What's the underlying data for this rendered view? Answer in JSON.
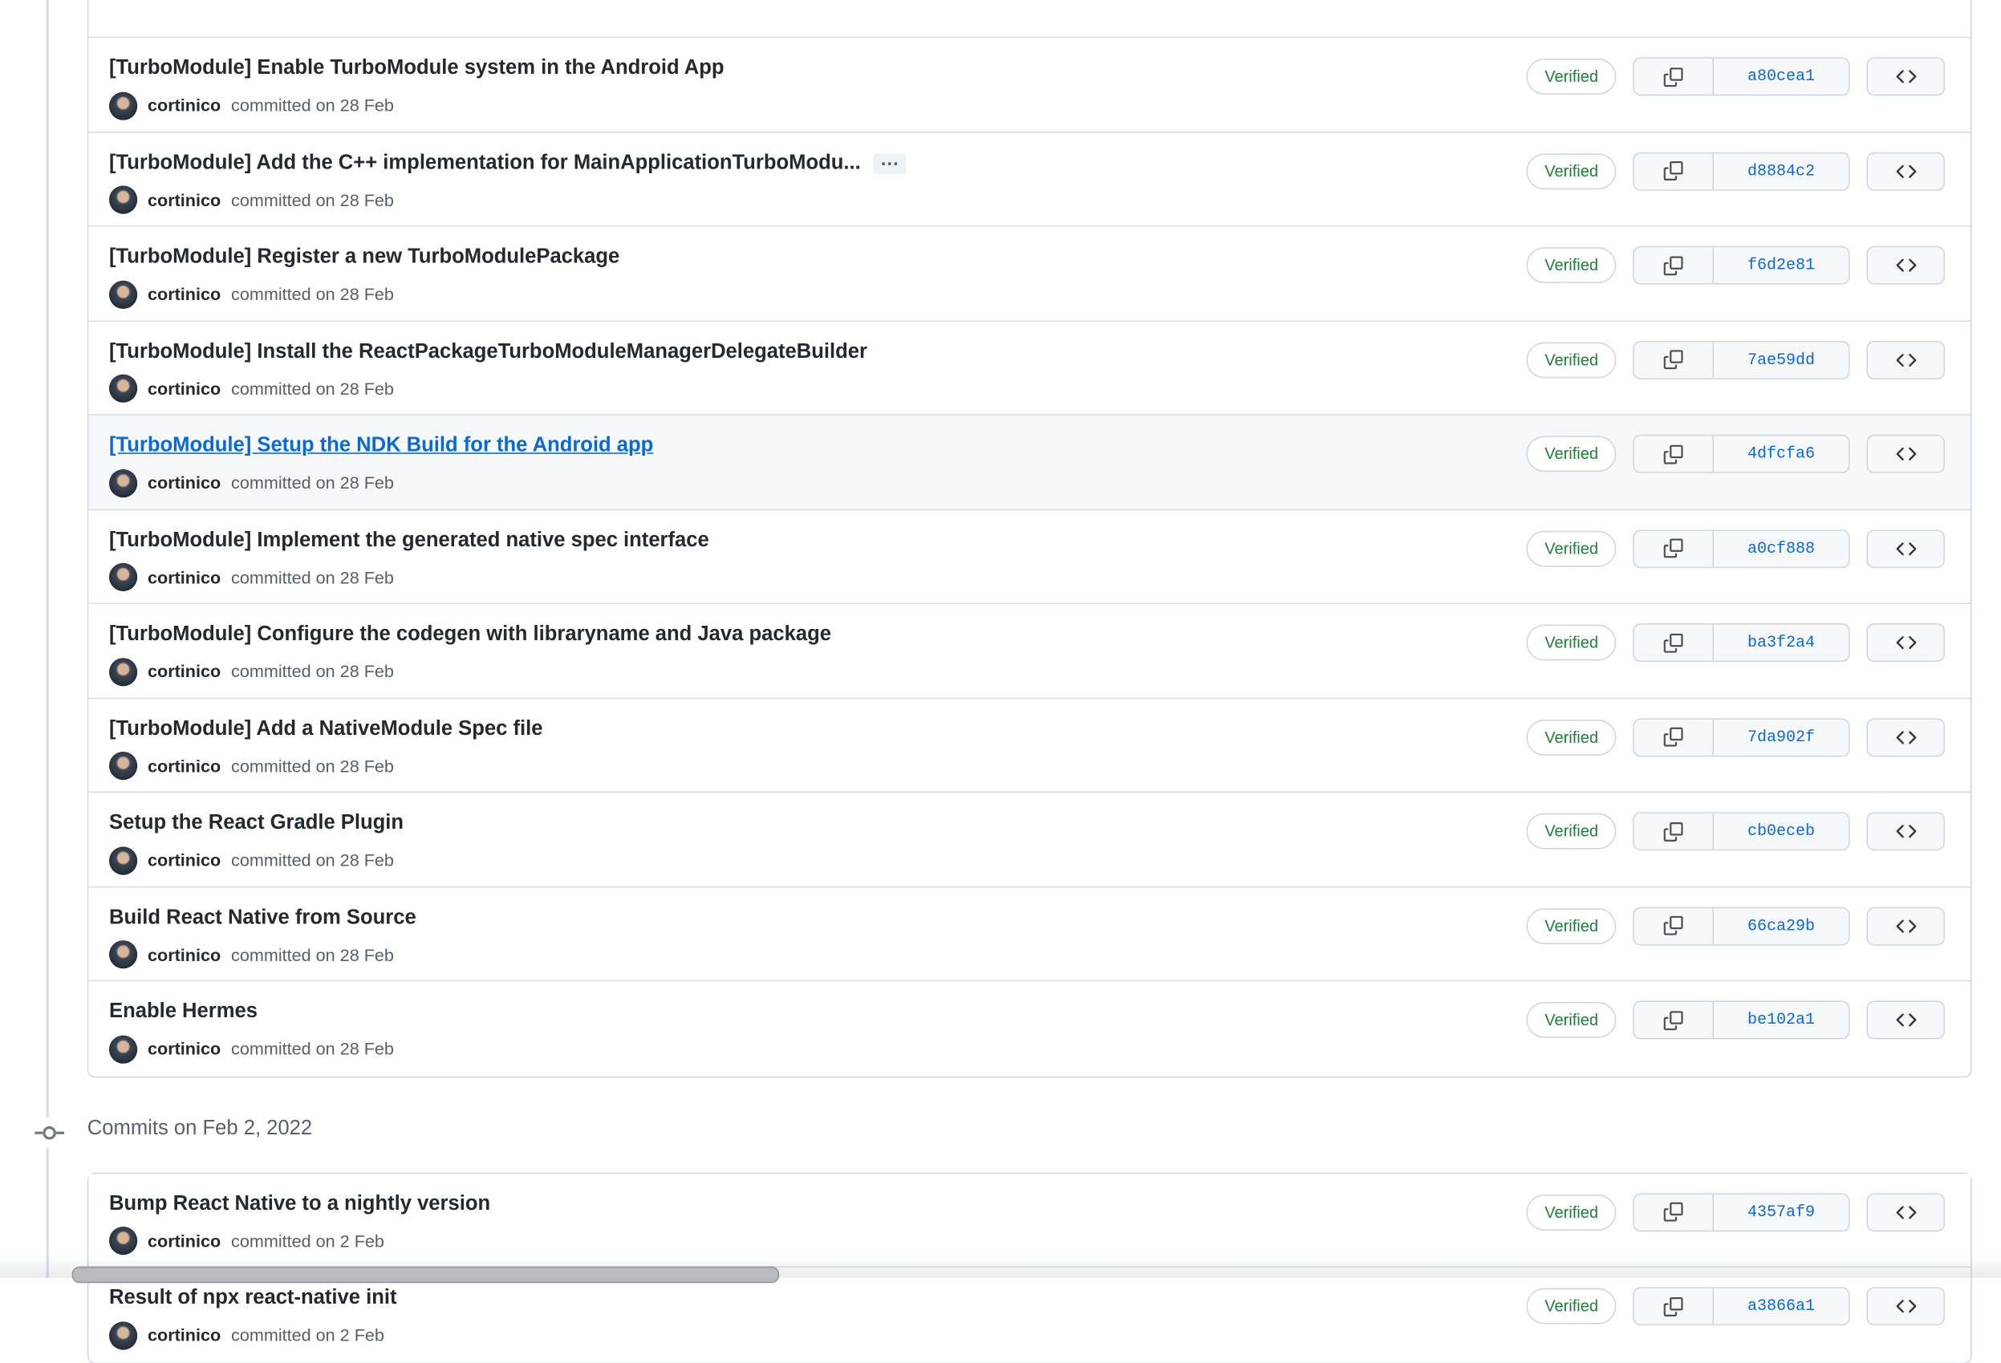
{
  "ui": {
    "verified_label": "Verified",
    "expander_label": "…",
    "colors": {
      "link_blue": "#0969da",
      "verified_green": "#1a7f37",
      "container_border": "#d0d7de",
      "row_divider": "#d8dee4",
      "muted_text": "#57606a",
      "title_text": "#24292f",
      "button_bg": "#f6f8fa",
      "highlight_row_bg": "#f6f8fa",
      "timeline_line": "#d8dee4"
    },
    "icons": {
      "copy_icon": "two overlapping squares (copy to clipboard)",
      "code_icon": "angle brackets < > (browse repository at this point)",
      "commit_node_icon": "git commit node (circle with side stubs)",
      "expander_icon": "horizontal ellipsis"
    }
  },
  "groups": [
    {
      "commits": [
        {
          "title": "[TurboModule] Enable TurboModule system in the Android App",
          "author": "cortinico",
          "committed": "committed on 28 Feb",
          "sha": "a80cea1",
          "verified": true
        },
        {
          "title": "[TurboModule] Add the C++ implementation for MainApplicationTurboModu...",
          "has_expander": true,
          "author": "cortinico",
          "committed": "committed on 28 Feb",
          "sha": "d8884c2",
          "verified": true
        },
        {
          "title": "[TurboModule] Register a new TurboModulePackage",
          "author": "cortinico",
          "committed": "committed on 28 Feb",
          "sha": "f6d2e81",
          "verified": true
        },
        {
          "title": "[TurboModule] Install the ReactPackageTurboModuleManagerDelegateBuilder",
          "author": "cortinico",
          "committed": "committed on 28 Feb",
          "sha": "7ae59dd",
          "verified": true
        },
        {
          "title": "[TurboModule] Setup the NDK Build for the Android app",
          "is_link": true,
          "highlighted": true,
          "author": "cortinico",
          "committed": "committed on 28 Feb",
          "sha": "4dfcfa6",
          "verified": true
        },
        {
          "title": "[TurboModule] Implement the generated native spec interface",
          "author": "cortinico",
          "committed": "committed on 28 Feb",
          "sha": "a0cf888",
          "verified": true
        },
        {
          "title": "[TurboModule] Configure the codegen with libraryname and Java package",
          "author": "cortinico",
          "committed": "committed on 28 Feb",
          "sha": "ba3f2a4",
          "verified": true
        },
        {
          "title": "[TurboModule] Add a NativeModule Spec file",
          "author": "cortinico",
          "committed": "committed on 28 Feb",
          "sha": "7da902f",
          "verified": true
        },
        {
          "title": "Setup the React Gradle Plugin",
          "author": "cortinico",
          "committed": "committed on 28 Feb",
          "sha": "cb0eceb",
          "verified": true
        },
        {
          "title": "Build React Native from Source",
          "author": "cortinico",
          "committed": "committed on 28 Feb",
          "sha": "66ca29b",
          "verified": true
        },
        {
          "title": "Enable Hermes",
          "author": "cortinico",
          "committed": "committed on 28 Feb",
          "sha": "be102a1",
          "verified": true
        }
      ]
    },
    {
      "date_heading": "Commits on Feb 2, 2022",
      "commits": [
        {
          "title": "Bump React Native to a nightly version",
          "author": "cortinico",
          "committed": "committed on 2 Feb",
          "sha": "4357af9",
          "verified": true
        },
        {
          "title": "Result of npx react-native init",
          "author": "cortinico",
          "committed": "committed on 2 Feb",
          "sha": "a3866a1",
          "verified": true
        }
      ]
    }
  ]
}
